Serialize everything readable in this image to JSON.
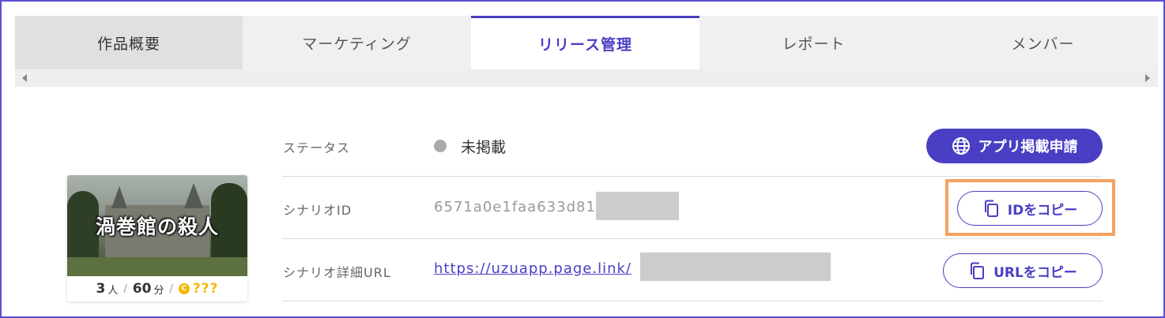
{
  "tabs": [
    {
      "label": "作品概要"
    },
    {
      "label": "マーケティング"
    },
    {
      "label": "リリース管理"
    },
    {
      "label": "レポート"
    },
    {
      "label": "メンバー"
    }
  ],
  "active_tab": "リリース管理",
  "card": {
    "image_title": "渦巻館の殺人",
    "players": "3",
    "players_unit": "人",
    "duration": "60",
    "duration_unit": "分",
    "coin_icon": "C",
    "price": "???"
  },
  "status": {
    "label": "ステータス",
    "value": "未掲載",
    "dot_color": "#aaaaaa",
    "button_label": "アプリ掲載申請",
    "button_icon": "globe-icon"
  },
  "scenario_id": {
    "label": "シナリオID",
    "value": "6571a0e1faa633d81",
    "button_label": "IDをコピー",
    "button_icon": "copy-icon"
  },
  "scenario_url": {
    "label": "シナリオ詳細URL",
    "value": "https://uzuapp.page.link/",
    "button_label": "URLをコピー",
    "button_icon": "copy-icon"
  },
  "colors": {
    "accent": "#4a3fc4",
    "highlight": "#f4a261",
    "price": "#f5b800"
  }
}
